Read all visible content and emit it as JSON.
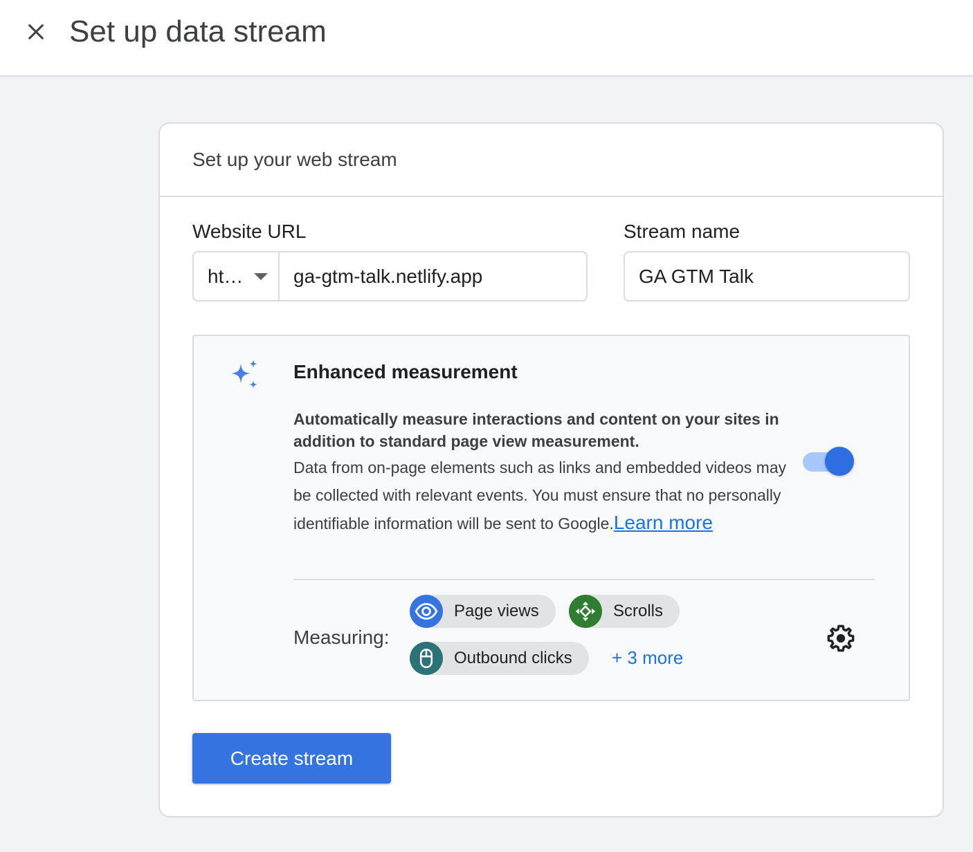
{
  "header": {
    "title": "Set up data stream"
  },
  "card": {
    "title": "Set up your web stream",
    "website_url": {
      "label": "Website URL",
      "protocol": "ht…",
      "value": "ga-gtm-talk.netlify.app"
    },
    "stream_name": {
      "label": "Stream name",
      "value": "GA GTM Talk"
    },
    "enhanced": {
      "title": "Enhanced measurement",
      "desc_bold": "Automatically measure interactions and content on your sites in addition to standard page view measurement.",
      "desc": "Data from on-page elements such as links and embedded videos may be collected with relevant events. You must ensure that no personally identifiable information will be sent to Google.",
      "learn_more": "Learn more",
      "enabled": true,
      "measuring_label": "Measuring:",
      "chips": [
        {
          "label": "Page views",
          "icon": "eye-icon",
          "color": "#3574e0"
        },
        {
          "label": "Scrolls",
          "icon": "scroll-arrows-icon",
          "color": "#2e7d32"
        },
        {
          "label": "Outbound clicks",
          "icon": "mouse-icon",
          "color": "#2c7377"
        }
      ],
      "more": "+ 3 more"
    },
    "create_button": "Create stream"
  },
  "colors": {
    "primary": "#3574e0",
    "toggle_track": "#a8c7fa",
    "link": "#1a73e8",
    "spark": "#4a7fe0"
  }
}
